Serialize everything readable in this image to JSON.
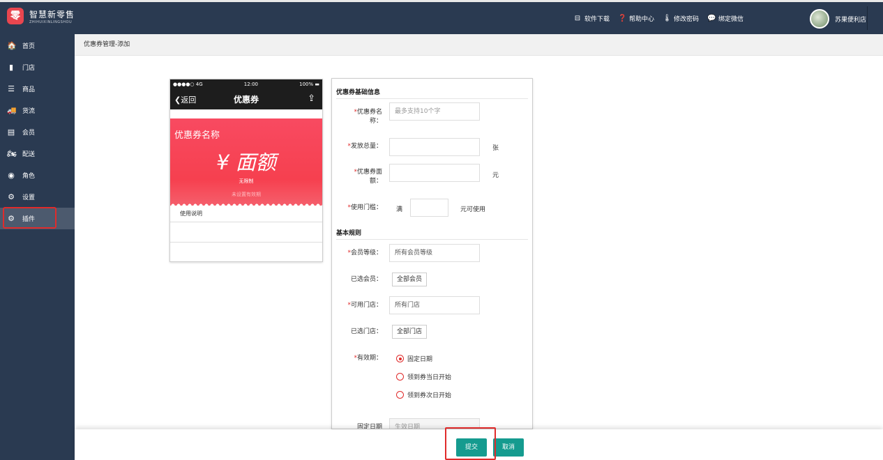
{
  "app": {
    "logo_mark": "零",
    "logo_title": "智慧新零售",
    "logo_sub": "ZHIHUIXINLINGSHOU"
  },
  "topnav": [
    {
      "label": "软件下载",
      "icon": "download-icon"
    },
    {
      "label": "帮助中心",
      "icon": "help-icon"
    },
    {
      "label": "修改密码",
      "icon": "thermometer-icon"
    },
    {
      "label": "绑定微信",
      "icon": "wechat-icon"
    }
  ],
  "user": {
    "name": "苏果便利店"
  },
  "sidebar": {
    "items": [
      {
        "label": "首页",
        "icon": "home-icon"
      },
      {
        "label": "门店",
        "icon": "store-icon"
      },
      {
        "label": "商品",
        "icon": "list-icon"
      },
      {
        "label": "货流",
        "icon": "truck-icon"
      },
      {
        "label": "会员",
        "icon": "member-card-icon"
      },
      {
        "label": "配送",
        "icon": "motorcycle-icon"
      },
      {
        "label": "角色",
        "icon": "user-circle-icon"
      },
      {
        "label": "设置",
        "icon": "gear-icon"
      },
      {
        "label": "插件",
        "icon": "plugin-gears-icon"
      }
    ],
    "active_index": 8
  },
  "breadcrumb": "优惠券管理-添加",
  "phone": {
    "carrier": "●●●●○ 4G",
    "time": "12:00",
    "battery": "100%",
    "back_label": "返回",
    "title": "优惠券",
    "coupon_name": "优惠券名称",
    "amount": "¥ 面额",
    "limit": "无限制",
    "expire": "未设置有效期",
    "usage_label": "使用说明"
  },
  "form": {
    "section_basic": "优惠券基础信息",
    "name_label_1": "优惠券名",
    "name_label_2": "称：",
    "name_placeholder": "最多支持10个字",
    "total_label": "发放总量：",
    "total_unit": "张",
    "value_label_1": "优惠券面",
    "value_label_2": "额：",
    "value_unit": "元",
    "threshold_label": "使用门槛：",
    "threshold_prefix": "满",
    "threshold_suffix": "元可使用",
    "section_rules": "基本规则",
    "level_label": "会员等级：",
    "level_value": "所有会员等级",
    "members_label": "已选会员：",
    "members_chip": "全部会员",
    "stores_label": "可用门店：",
    "stores_value": "所有门店",
    "selected_stores_label": "已选门店：",
    "selected_stores_chip": "全部门店",
    "validity_label": "有效期：",
    "validity_options": [
      "固定日期",
      "领到券当日开始",
      "领到券次日开始"
    ],
    "fixed_date_label": "固定日期",
    "fixed_date_placeholder": "生效日期"
  },
  "footer": {
    "submit": "提交",
    "cancel": "取消"
  }
}
